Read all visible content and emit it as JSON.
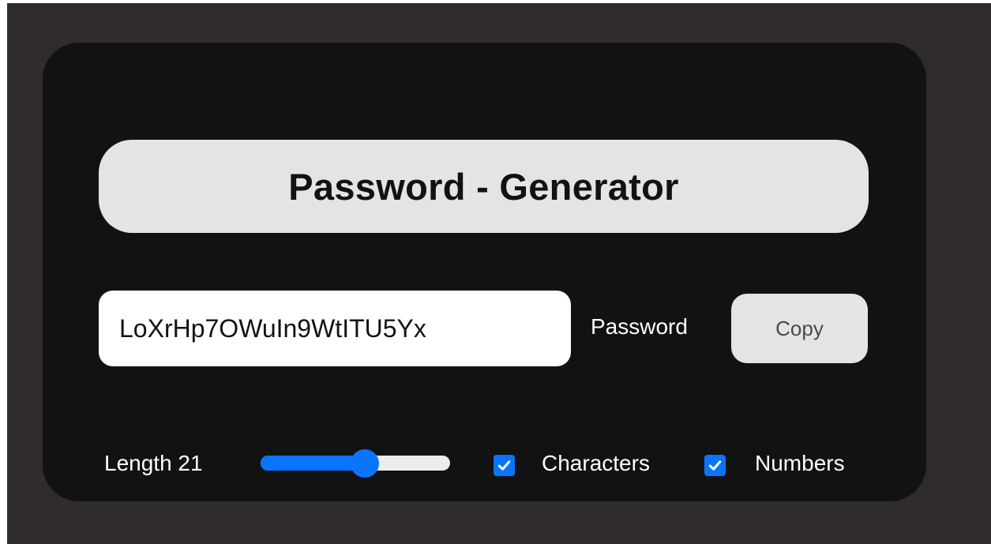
{
  "app": {
    "title": "Password - Generator"
  },
  "password": {
    "value": "LoXrHp7OWuIn9WtITU5Yx",
    "label": "Password"
  },
  "copy_button": {
    "label": "Copy"
  },
  "length": {
    "label": "Length 21",
    "value": 21,
    "slider_fraction": 0.56
  },
  "options": {
    "characters": {
      "label": "Characters",
      "checked": true
    },
    "numbers": {
      "label": "Numbers",
      "checked": true
    }
  },
  "colors": {
    "page_background": "#302b2c",
    "card_background": "#121212",
    "title_background": "#e4e4e4",
    "accent": "#0a74fc",
    "text_light": "#ffffff",
    "text_dark": "#121212"
  }
}
